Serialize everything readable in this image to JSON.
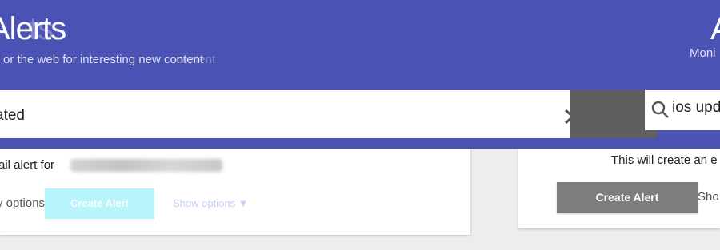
{
  "header": {
    "title": "Alerts",
    "title_ghost": "ts",
    "title_right": "A",
    "subtitle": "or the web for interesting new content",
    "subtitle_ghost": "content",
    "subtitle_right": "Moni"
  },
  "search": {
    "query": "ated",
    "query_right": "ios upd"
  },
  "result": {
    "info_left": "ail alert for",
    "info_right": "This will create an e",
    "options_left": "v options",
    "options_caret": "▼",
    "create_alert_left": "Create Alert",
    "show_options_ghost": "Show options ▼",
    "create_alert_right": "Create Alert",
    "options_right": "Sho"
  },
  "colors": {
    "header": "#4a52b3",
    "create_button_right": "#7d7d7d",
    "create_button_left": "#b8f4fb"
  },
  "icons": {
    "clear": "close-icon",
    "search": "search-icon"
  }
}
